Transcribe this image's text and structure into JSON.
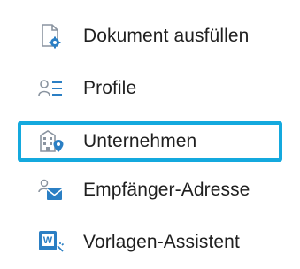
{
  "menu": {
    "items": [
      {
        "label": "Dokument ausfüllen",
        "icon": "document-fill-icon",
        "selected": false
      },
      {
        "label": "Profile",
        "icon": "profiles-list-icon",
        "selected": false
      },
      {
        "label": "Unternehmen",
        "icon": "company-building-icon",
        "selected": true
      },
      {
        "label": "Empfänger-Adresse",
        "icon": "recipient-address-icon",
        "selected": false
      },
      {
        "label": "Vorlagen-Assistent",
        "icon": "template-wizard-icon",
        "selected": false
      }
    ],
    "colors": {
      "selection_border": "#14a9de",
      "icon_blue": "#2b7fc4",
      "icon_gray": "#7f8a96",
      "text": "#1f1f1f"
    }
  }
}
